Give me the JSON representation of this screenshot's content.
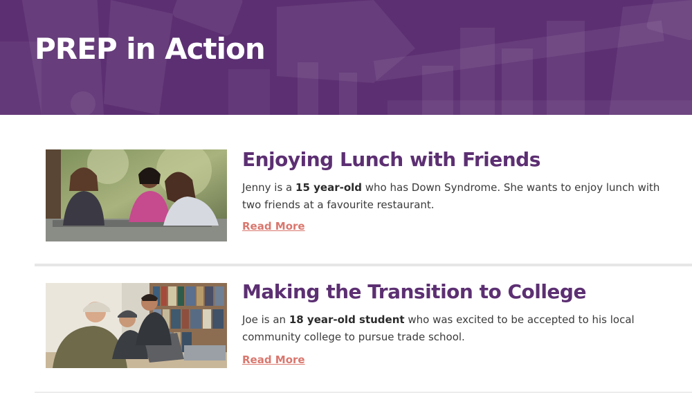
{
  "hero": {
    "title": "PREP in Action",
    "background_color": "#5c2f72"
  },
  "stories": [
    {
      "title": "Enjoying Lunch with Friends",
      "desc_prefix": "Jenny is a ",
      "desc_bold": "15 year-old",
      "desc_suffix": " who has Down Syndrome. She wants to enjoy lunch with two friends at a favourite restaurant.",
      "link_label": "Read More",
      "image_icon": "photo-friends-lunch"
    },
    {
      "title": "Making the Transition to College",
      "desc_prefix": "Joe is an ",
      "desc_bold": "18 year-old student",
      "desc_suffix": " who was excited to be accepted to his local community college to pursue trade school.",
      "link_label": "Read More",
      "image_icon": "photo-students-laptop"
    }
  ],
  "colors": {
    "title": "#5c2f72",
    "link": "#d9776e"
  }
}
